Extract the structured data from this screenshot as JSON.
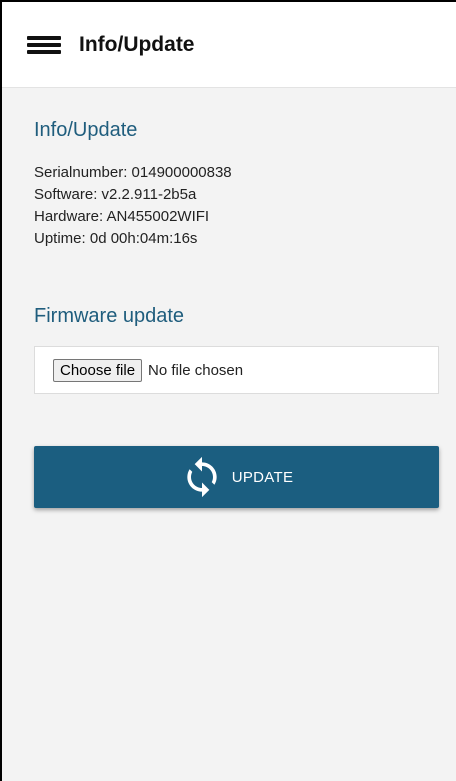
{
  "header": {
    "title": "Info/Update",
    "menu_icon": "hamburger-menu-icon"
  },
  "info": {
    "heading": "Info/Update",
    "serial": "Serialnumber: 014900000838",
    "software": "Software: v2.2.911-2b5a",
    "hardware": "Hardware: AN455002WIFI",
    "uptime": "Uptime: 0d 00h:04m:16s"
  },
  "firmware": {
    "heading": "Firmware update",
    "choose_file_label": "Choose file",
    "file_status": "No file chosen"
  },
  "update_button": {
    "label": "UPDATE",
    "icon": "refresh-icon"
  },
  "colors": {
    "accent": "#1b5e80",
    "heading": "#1f5d7d",
    "background": "#f3f3f3"
  }
}
